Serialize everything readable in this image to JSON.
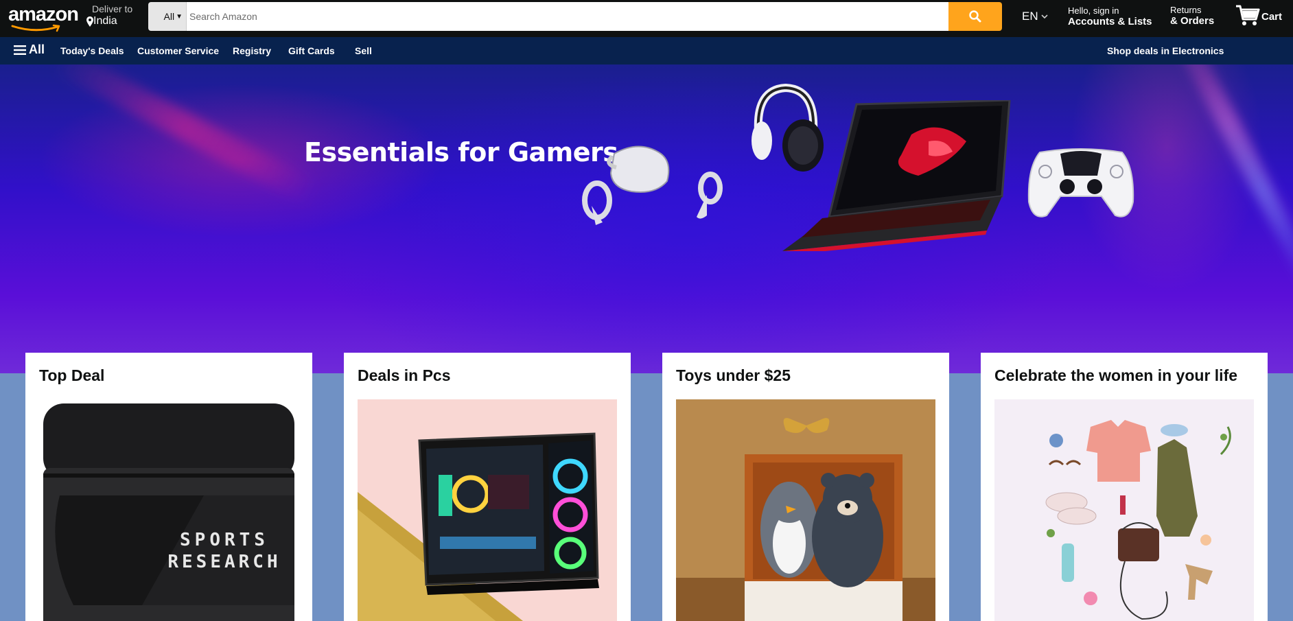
{
  "header": {
    "logo_text": "amazon",
    "deliver_line1": "Deliver to",
    "deliver_line2": "India",
    "search_category": "All",
    "search_placeholder": "Search Amazon",
    "language": "EN",
    "account_line1": "Hello, sign in",
    "account_line2": "Accounts & Lists",
    "returns_line1": "Returns",
    "returns_line2": "& Orders",
    "cart_label": "Cart"
  },
  "nav": {
    "all_label": "All",
    "items": [
      "Today's Deals",
      "Customer Service",
      "Registry",
      "Gift Cards",
      "Sell"
    ],
    "promo": "Shop deals in Electronics"
  },
  "hero": {
    "title": "Essentials for Gamers"
  },
  "cards": [
    {
      "title": "Top Deal",
      "image_text_1": "SPORTS",
      "image_text_2": "RESEARCH"
    },
    {
      "title": "Deals in Pcs"
    },
    {
      "title": "Toys under $25"
    },
    {
      "title": "Celebrate the women in your life"
    }
  ],
  "colors": {
    "header_bg": "#0f1111",
    "nav_bg": "#08224e",
    "search_button": "#ffa41c",
    "page_bg": "#7091c4"
  }
}
